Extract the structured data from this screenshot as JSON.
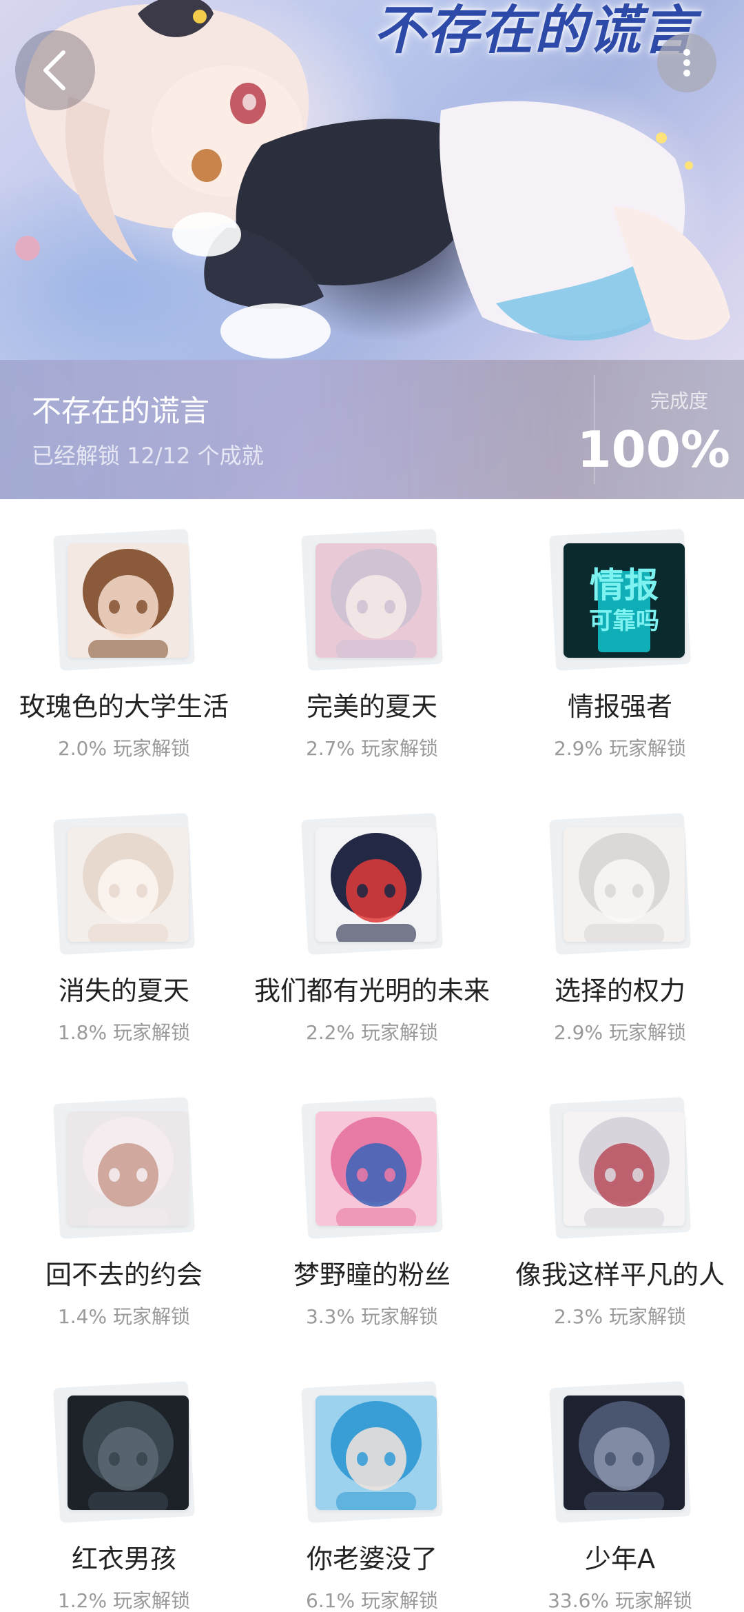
{
  "hero": {
    "art_title": "不存在的谎言",
    "game_title": "不存在的谎言",
    "unlock_summary": "已经解锁 12/12 个成就",
    "completion_label": "完成度",
    "completion_value": "100%"
  },
  "icons": {
    "back": "chevron-left-icon",
    "more": "vertical-dots-icon"
  },
  "achievements": [
    {
      "title": "玫瑰色的大学生活",
      "rate": "2.0% 玩家解锁",
      "colors": [
        "#f3e9e2",
        "#8a5a3a",
        "#f6dccd"
      ]
    },
    {
      "title": "完美的夏天",
      "rate": "2.7% 玩家解锁",
      "colors": [
        "#e9c9d6",
        "#cfc3d3",
        "#f5ece8"
      ]
    },
    {
      "title": "情报强者",
      "rate": "2.9% 玩家解锁",
      "colors": [
        "#0b2a2e",
        "#12c7cf",
        "#7ef2f0"
      ],
      "thumb_text": [
        "情报",
        "可靠吗"
      ]
    },
    {
      "title": "消失的夏天",
      "rate": "1.8% 玩家解锁",
      "colors": [
        "#f4eeea",
        "#e8d9cf",
        "#fbf6f2"
      ]
    },
    {
      "title": "我们都有光明的未来",
      "rate": "2.2% 玩家解锁",
      "colors": [
        "#f3f3f6",
        "#232844",
        "#e03a3a"
      ]
    },
    {
      "title": "选择的权力",
      "rate": "2.9% 玩家解锁",
      "colors": [
        "#f4f1ef",
        "#dcd8d8",
        "#faf8f6"
      ]
    },
    {
      "title": "回不去的约会",
      "rate": "1.4% 玩家解锁",
      "colors": [
        "#ece7e8",
        "#f4ecef",
        "#c99c8e"
      ]
    },
    {
      "title": "梦野瞳的粉丝",
      "rate": "3.3% 玩家解锁",
      "colors": [
        "#f7c6d8",
        "#e87aa6",
        "#3a63b8"
      ]
    },
    {
      "title": "像我这样平凡的人",
      "rate": "2.3% 玩家解锁",
      "colors": [
        "#f5f3f4",
        "#d9d4dc",
        "#b94c5c"
      ]
    },
    {
      "title": "红衣男孩",
      "rate": "1.2% 玩家解锁",
      "colors": [
        "#1c2228",
        "#3a4650",
        "#5d6a74"
      ]
    },
    {
      "title": "你老婆没了",
      "rate": "6.1% 玩家解锁",
      "colors": [
        "#9cd2ee",
        "#3a9ed6",
        "#f3e3da"
      ]
    },
    {
      "title": "少年A",
      "rate": "33.6% 玩家解锁",
      "colors": [
        "#1e2230",
        "#4a5570",
        "#8b95ad"
      ]
    }
  ]
}
